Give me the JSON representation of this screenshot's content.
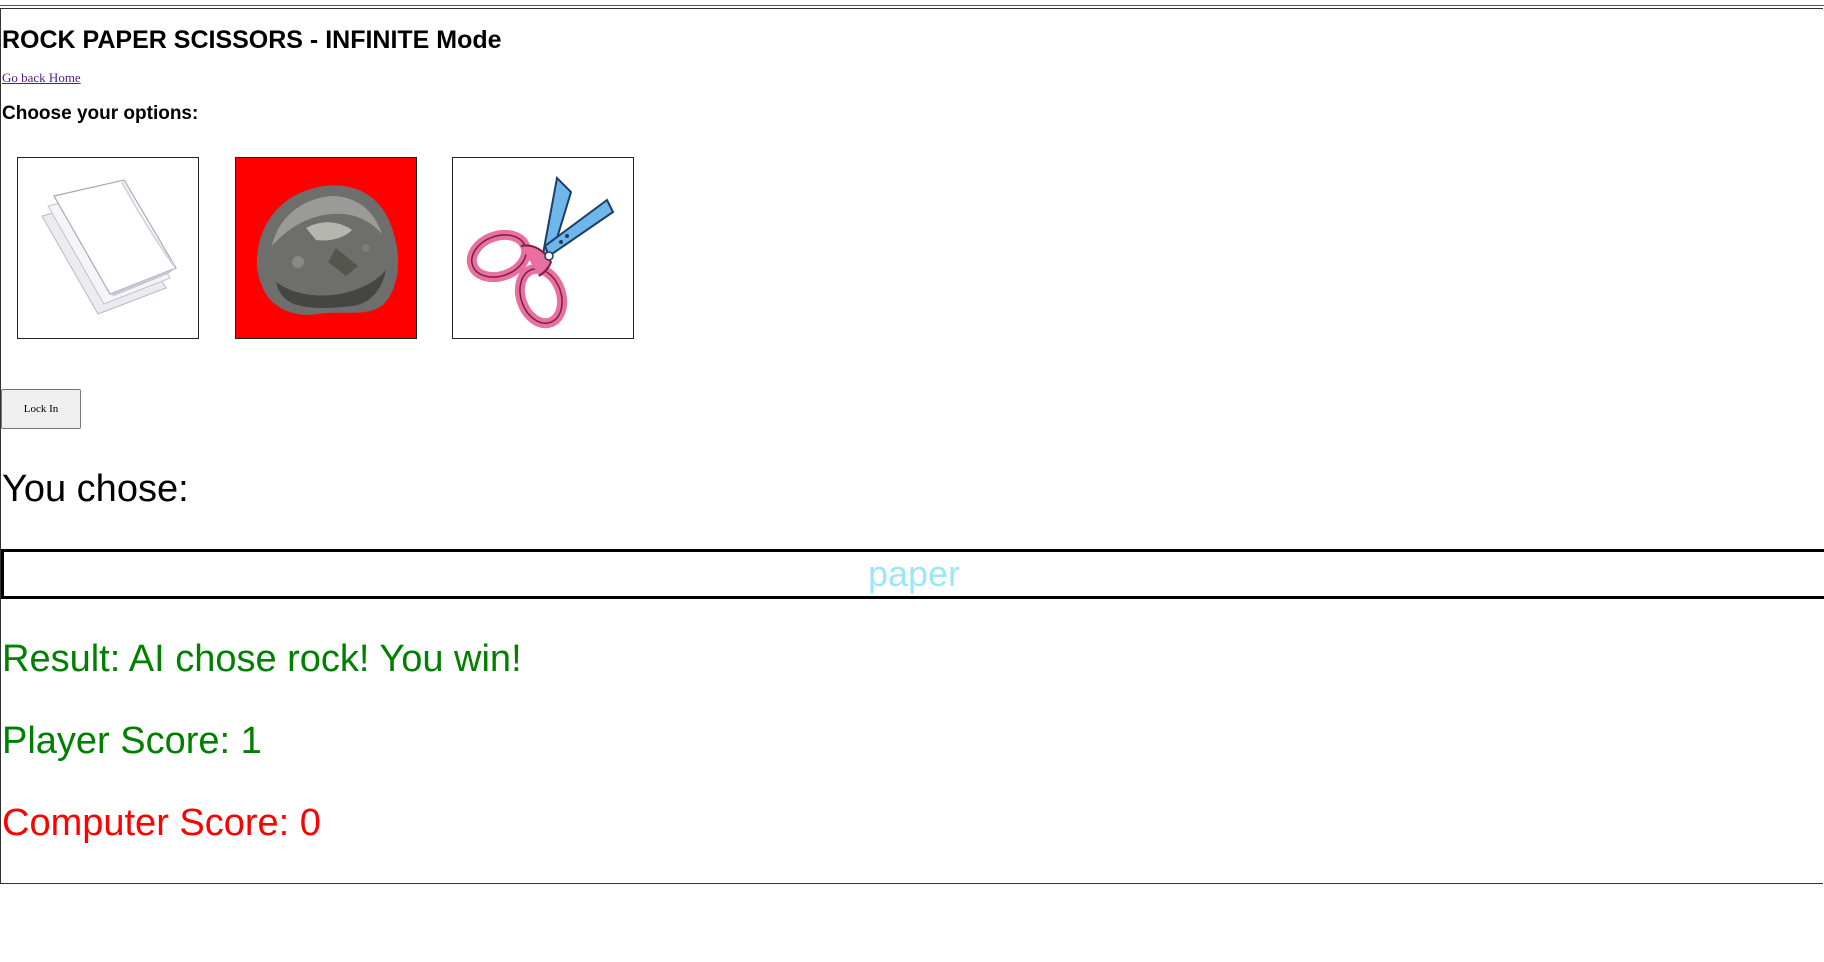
{
  "header": {
    "title": "ROCK PAPER SCISSORS - INFINITE Mode",
    "home_link": "Go back Home"
  },
  "options": {
    "heading": "Choose your options:",
    "items": [
      {
        "name": "paper",
        "icon": "paper-icon",
        "selected": false
      },
      {
        "name": "rock",
        "icon": "rock-icon",
        "selected": true
      },
      {
        "name": "scissors",
        "icon": "scissors-icon",
        "selected": false
      }
    ],
    "selected_color": "#ff0000"
  },
  "controls": {
    "lock_label": "Lock In"
  },
  "choice": {
    "heading": "You chose:",
    "value": "paper",
    "value_color": "#9be7f7"
  },
  "result": {
    "text": "Result: AI chose rock! You win!",
    "color": "#008000"
  },
  "scores": {
    "player": "Player Score: 1",
    "player_color": "#008000",
    "computer": "Computer Score: 0",
    "computer_color": "#ff0000"
  }
}
